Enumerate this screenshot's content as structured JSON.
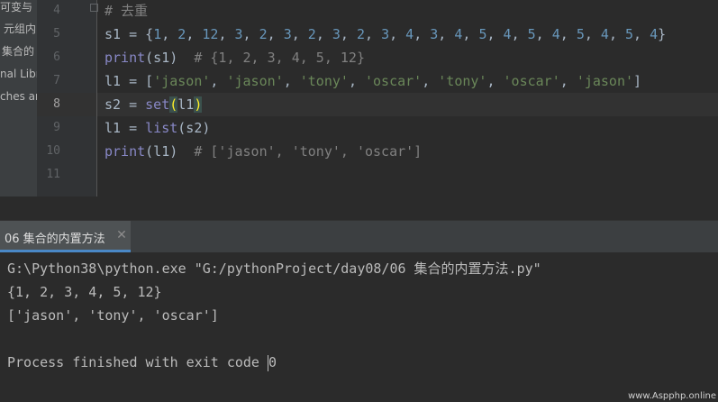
{
  "project_tree": {
    "items": [
      "可变与",
      "元组内",
      "集合的",
      "nal Libr",
      "ches ar"
    ]
  },
  "editor": {
    "lines": [
      {
        "num": "4",
        "text": "# 去重"
      },
      {
        "num": "5",
        "text": "s1 = {1, 2, 12, 3, 2, 3, 2, 3, 2, 3, 4, 3, 4, 5, 4, 5, 4, 5, 4, 5, 4}"
      },
      {
        "num": "6",
        "text": "print(s1)  # {1, 2, 3, 4, 5, 12}"
      },
      {
        "num": "7",
        "text": "l1 = ['jason', 'jason', 'tony', 'oscar', 'tony', 'oscar', 'jason']"
      },
      {
        "num": "8",
        "text": "s2 = set(l1)"
      },
      {
        "num": "9",
        "text": "l1 = list(s2)"
      },
      {
        "num": "10",
        "text": "print(l1)  # ['jason', 'tony', 'oscar']"
      },
      {
        "num": "11",
        "text": ""
      }
    ],
    "current_line": "8"
  },
  "run_panel": {
    "tab_label": "06 集合的内置方法",
    "close_label": "✕",
    "console_lines": [
      "G:\\Python38\\python.exe \"G:/pythonProject/day08/06 集合的内置方法.py\"",
      "{1, 2, 3, 4, 5, 12}",
      "['jason', 'tony', 'oscar']",
      "",
      "Process finished with exit code ",
      "0"
    ]
  },
  "watermark": "www.Aspphp.online",
  "colors": {
    "keyword": "#8888c6",
    "number": "#6897bb",
    "string": "#6a8759",
    "comment": "#808080",
    "default_text": "#a9b7c6",
    "tab_underline": "#4a88c7"
  }
}
